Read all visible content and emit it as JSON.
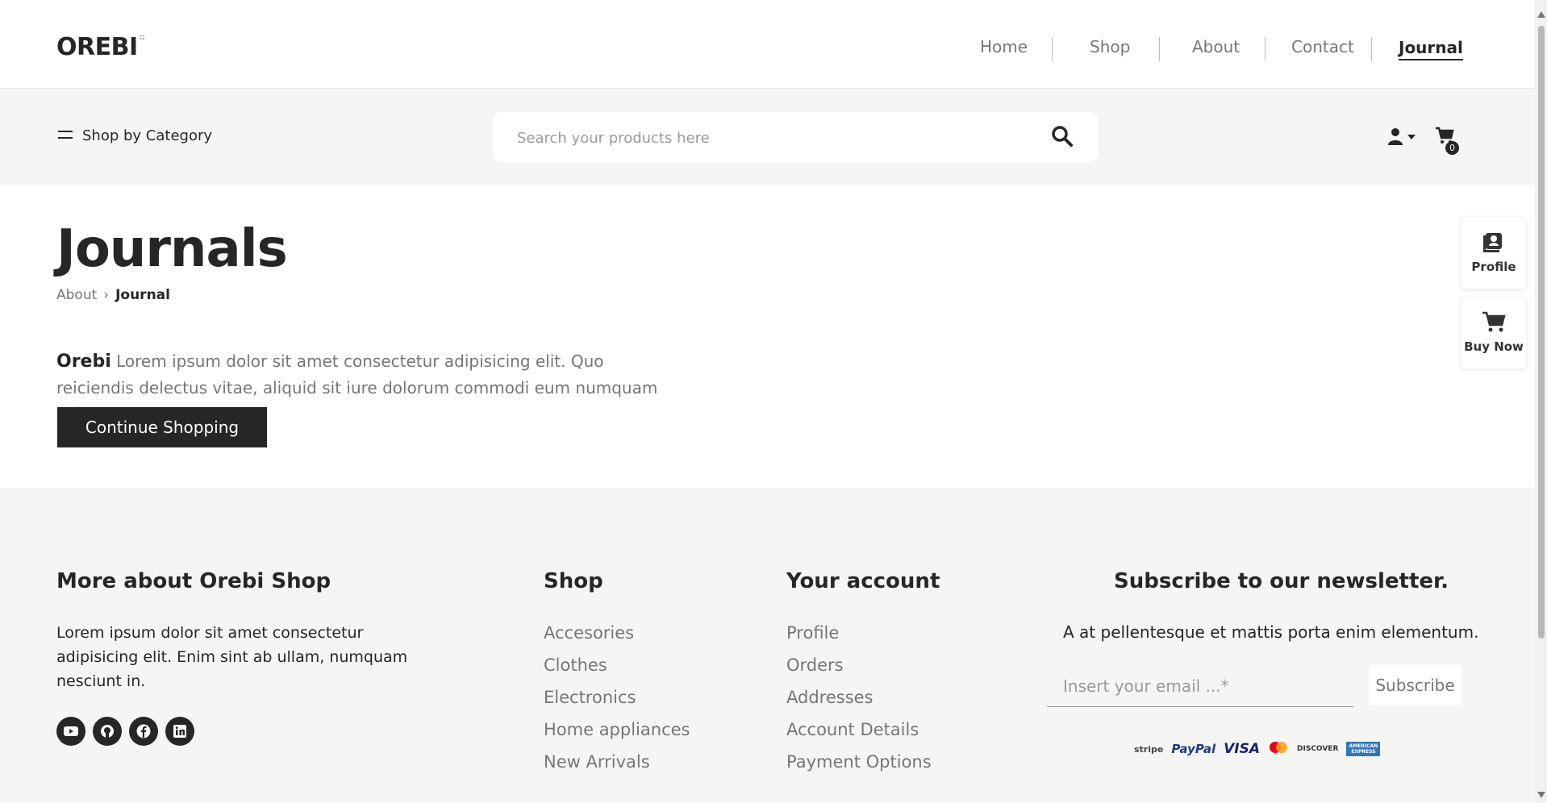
{
  "brand": {
    "logo": "OREBI",
    "logo_mark": "::"
  },
  "nav": {
    "links": [
      "Home",
      "Shop",
      "About",
      "Contact",
      "Journal"
    ],
    "active": "Journal"
  },
  "searchbar": {
    "category_label": "Shop by Category",
    "placeholder": "Search your products here",
    "cart_count": "0"
  },
  "hero": {
    "title": "Journals",
    "breadcrumb": {
      "parent": "About",
      "separator": "›",
      "current": "Journal"
    },
    "brand_word": "Orebi",
    "intro": " Lorem ipsum dolor sit amet consectetur adipisicing elit. Quo reiciendis delectus vitae, aliquid sit iure dolorum commodi eum numquam voluptate!",
    "button": "Continue Shopping"
  },
  "side": {
    "profile": "Profile",
    "buy_now": "Buy Now"
  },
  "footer": {
    "about": {
      "heading": "More about Orebi Shop",
      "text": "Lorem ipsum dolor sit amet consectetur adipisicing elit. Enim sint ab ullam, numquam nesciunt in.",
      "socials": [
        "youtube-icon",
        "github-icon",
        "facebook-icon",
        "linkedin-icon"
      ]
    },
    "shop": {
      "heading": "Shop",
      "links": [
        "Accesories",
        "Clothes",
        "Electronics",
        "Home appliances",
        "New Arrivals"
      ]
    },
    "account": {
      "heading": "Your account",
      "links": [
        "Profile",
        "Orders",
        "Addresses",
        "Account Details",
        "Payment Options"
      ]
    },
    "newsletter": {
      "heading": "Subscribe to our newsletter.",
      "subtext": "A at pellentesque et mattis porta enim elementum.",
      "placeholder": "Insert your email ...*",
      "button": "Subscribe",
      "payments": [
        "stripe",
        "PayPal",
        "VISA",
        "DISCOVER",
        "AMERICAN EXPRESS"
      ]
    }
  },
  "colors": {
    "primary": "#262626",
    "muted": "#767676",
    "band": "#f5f5f3"
  }
}
